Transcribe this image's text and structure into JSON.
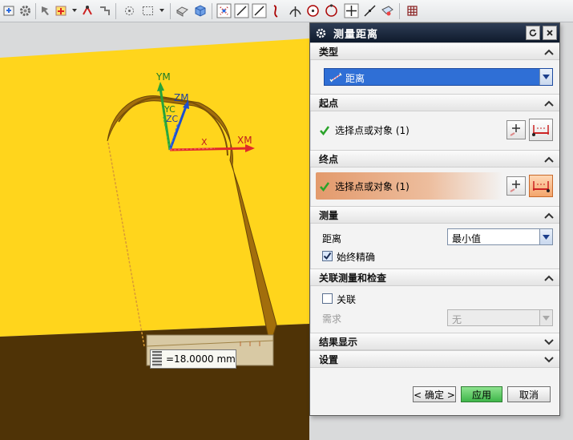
{
  "toolbar": {
    "icons": [
      "snap-icon",
      "gear-icon",
      "select-icon",
      "point-icon",
      "component-icon",
      "transform-icon",
      "circle-select-icon",
      "box-select-icon",
      "shaded-view-icon",
      "solid-cube-icon",
      "point-snap-icon",
      "line-endpoint-icon",
      "line-icon",
      "curve-icon",
      "intersection-icon",
      "arc-center-icon",
      "quadrant-icon",
      "existing-point-icon",
      "point-on-curve-icon",
      "point-on-face-icon",
      "grid-icon"
    ]
  },
  "viewport": {
    "axis_labels": {
      "ym": "YM",
      "yc": "YC",
      "zm": "ZM",
      "zc": "ZC",
      "xm": "XM",
      "xc": "X"
    },
    "measure_value": "=18.0000 mm",
    "dim_label": "18",
    "colors": {
      "face": "#ffd51c",
      "ground": "#4f3306",
      "background": "#d9dadb",
      "part_wall": "#a26e0c"
    }
  },
  "dialog": {
    "title": "测量距离",
    "sections": {
      "type": {
        "header": "类型",
        "value": "距离"
      },
      "start": {
        "header": "起点",
        "selection": "选择点或对象 (1)"
      },
      "end": {
        "header": "终点",
        "selection": "选择点或对象 (1)"
      },
      "measure": {
        "header": "测量",
        "distance_label": "距离",
        "distance_value": "最小值",
        "exact_label": "始终精确",
        "exact_checked": true
      },
      "assoc": {
        "header": "关联测量和检查",
        "assoc_label": "关联",
        "assoc_checked": false,
        "require_label": "需求",
        "require_value": "无"
      },
      "results": {
        "header": "结果显示"
      },
      "settings": {
        "header": "设置"
      }
    },
    "buttons": {
      "ok": "< 确定 >",
      "apply": "应用",
      "cancel": "取消"
    },
    "colors": {
      "title_bg": "#17243a",
      "highlight": "#e7a47a",
      "check": "#2aa32a",
      "combo_sel": "#2f6fd6",
      "apply_green": "#47c24c"
    }
  }
}
